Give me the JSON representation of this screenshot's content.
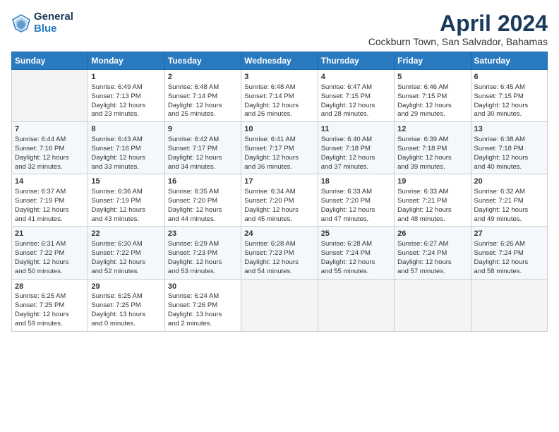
{
  "header": {
    "logo_general": "General",
    "logo_blue": "Blue",
    "month_title": "April 2024",
    "subtitle": "Cockburn Town, San Salvador, Bahamas"
  },
  "days_of_week": [
    "Sunday",
    "Monday",
    "Tuesday",
    "Wednesday",
    "Thursday",
    "Friday",
    "Saturday"
  ],
  "weeks": [
    [
      {
        "day": "",
        "info": ""
      },
      {
        "day": "1",
        "info": "Sunrise: 6:49 AM\nSunset: 7:13 PM\nDaylight: 12 hours\nand 23 minutes."
      },
      {
        "day": "2",
        "info": "Sunrise: 6:48 AM\nSunset: 7:14 PM\nDaylight: 12 hours\nand 25 minutes."
      },
      {
        "day": "3",
        "info": "Sunrise: 6:48 AM\nSunset: 7:14 PM\nDaylight: 12 hours\nand 26 minutes."
      },
      {
        "day": "4",
        "info": "Sunrise: 6:47 AM\nSunset: 7:15 PM\nDaylight: 12 hours\nand 28 minutes."
      },
      {
        "day": "5",
        "info": "Sunrise: 6:46 AM\nSunset: 7:15 PM\nDaylight: 12 hours\nand 29 minutes."
      },
      {
        "day": "6",
        "info": "Sunrise: 6:45 AM\nSunset: 7:15 PM\nDaylight: 12 hours\nand 30 minutes."
      }
    ],
    [
      {
        "day": "7",
        "info": "Sunrise: 6:44 AM\nSunset: 7:16 PM\nDaylight: 12 hours\nand 32 minutes."
      },
      {
        "day": "8",
        "info": "Sunrise: 6:43 AM\nSunset: 7:16 PM\nDaylight: 12 hours\nand 33 minutes."
      },
      {
        "day": "9",
        "info": "Sunrise: 6:42 AM\nSunset: 7:17 PM\nDaylight: 12 hours\nand 34 minutes."
      },
      {
        "day": "10",
        "info": "Sunrise: 6:41 AM\nSunset: 7:17 PM\nDaylight: 12 hours\nand 36 minutes."
      },
      {
        "day": "11",
        "info": "Sunrise: 6:40 AM\nSunset: 7:18 PM\nDaylight: 12 hours\nand 37 minutes."
      },
      {
        "day": "12",
        "info": "Sunrise: 6:39 AM\nSunset: 7:18 PM\nDaylight: 12 hours\nand 39 minutes."
      },
      {
        "day": "13",
        "info": "Sunrise: 6:38 AM\nSunset: 7:18 PM\nDaylight: 12 hours\nand 40 minutes."
      }
    ],
    [
      {
        "day": "14",
        "info": "Sunrise: 6:37 AM\nSunset: 7:19 PM\nDaylight: 12 hours\nand 41 minutes."
      },
      {
        "day": "15",
        "info": "Sunrise: 6:36 AM\nSunset: 7:19 PM\nDaylight: 12 hours\nand 43 minutes."
      },
      {
        "day": "16",
        "info": "Sunrise: 6:35 AM\nSunset: 7:20 PM\nDaylight: 12 hours\nand 44 minutes."
      },
      {
        "day": "17",
        "info": "Sunrise: 6:34 AM\nSunset: 7:20 PM\nDaylight: 12 hours\nand 45 minutes."
      },
      {
        "day": "18",
        "info": "Sunrise: 6:33 AM\nSunset: 7:20 PM\nDaylight: 12 hours\nand 47 minutes."
      },
      {
        "day": "19",
        "info": "Sunrise: 6:33 AM\nSunset: 7:21 PM\nDaylight: 12 hours\nand 48 minutes."
      },
      {
        "day": "20",
        "info": "Sunrise: 6:32 AM\nSunset: 7:21 PM\nDaylight: 12 hours\nand 49 minutes."
      }
    ],
    [
      {
        "day": "21",
        "info": "Sunrise: 6:31 AM\nSunset: 7:22 PM\nDaylight: 12 hours\nand 50 minutes."
      },
      {
        "day": "22",
        "info": "Sunrise: 6:30 AM\nSunset: 7:22 PM\nDaylight: 12 hours\nand 52 minutes."
      },
      {
        "day": "23",
        "info": "Sunrise: 6:29 AM\nSunset: 7:23 PM\nDaylight: 12 hours\nand 53 minutes."
      },
      {
        "day": "24",
        "info": "Sunrise: 6:28 AM\nSunset: 7:23 PM\nDaylight: 12 hours\nand 54 minutes."
      },
      {
        "day": "25",
        "info": "Sunrise: 6:28 AM\nSunset: 7:24 PM\nDaylight: 12 hours\nand 55 minutes."
      },
      {
        "day": "26",
        "info": "Sunrise: 6:27 AM\nSunset: 7:24 PM\nDaylight: 12 hours\nand 57 minutes."
      },
      {
        "day": "27",
        "info": "Sunrise: 6:26 AM\nSunset: 7:24 PM\nDaylight: 12 hours\nand 58 minutes."
      }
    ],
    [
      {
        "day": "28",
        "info": "Sunrise: 6:25 AM\nSunset: 7:25 PM\nDaylight: 12 hours\nand 59 minutes."
      },
      {
        "day": "29",
        "info": "Sunrise: 6:25 AM\nSunset: 7:25 PM\nDaylight: 13 hours\nand 0 minutes."
      },
      {
        "day": "30",
        "info": "Sunrise: 6:24 AM\nSunset: 7:26 PM\nDaylight: 13 hours\nand 2 minutes."
      },
      {
        "day": "",
        "info": ""
      },
      {
        "day": "",
        "info": ""
      },
      {
        "day": "",
        "info": ""
      },
      {
        "day": "",
        "info": ""
      }
    ]
  ]
}
